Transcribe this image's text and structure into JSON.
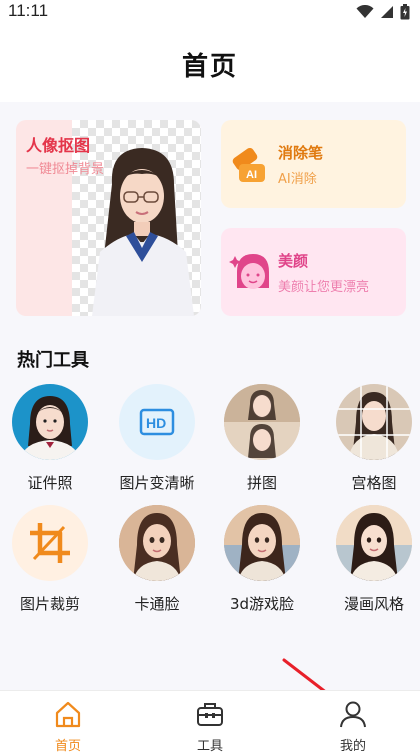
{
  "status": {
    "time": "11:11"
  },
  "header": {
    "title": "首页"
  },
  "feature_cards": {
    "cutout": {
      "title": "人像抠图",
      "subtitle": "一键抠掉背景"
    },
    "eraser": {
      "title": "消除笔",
      "subtitle": "AI消除",
      "badge": "AI"
    },
    "beauty": {
      "title": "美颜",
      "subtitle": "美颜让您更漂亮"
    }
  },
  "tools_section": {
    "title": "热门工具"
  },
  "tools": [
    {
      "label": "证件照",
      "icon": "id-photo-portrait"
    },
    {
      "label": "图片变清晰",
      "icon": "hd-icon",
      "icon_text": "HD"
    },
    {
      "label": "拼图",
      "icon": "collage-portrait"
    },
    {
      "label": "宫格图",
      "icon": "grid-portrait"
    },
    {
      "label": "图片裁剪",
      "icon": "crop-icon"
    },
    {
      "label": "卡通脸",
      "icon": "cartoon-portrait"
    },
    {
      "label": "3d游戏脸",
      "icon": "3d-portrait"
    },
    {
      "label": "漫画风格",
      "icon": "comic-portrait"
    }
  ],
  "tabbar": {
    "items": [
      {
        "label": "首页",
        "icon": "home-icon",
        "active": true
      },
      {
        "label": "工具",
        "icon": "toolbox-icon",
        "active": false
      },
      {
        "label": "我的",
        "icon": "user-icon",
        "active": false
      }
    ]
  },
  "colors": {
    "accent": "#f08a1c",
    "cutout_title": "#e4354a",
    "eraser_title": "#e07a10",
    "beauty_title": "#e0458a"
  }
}
